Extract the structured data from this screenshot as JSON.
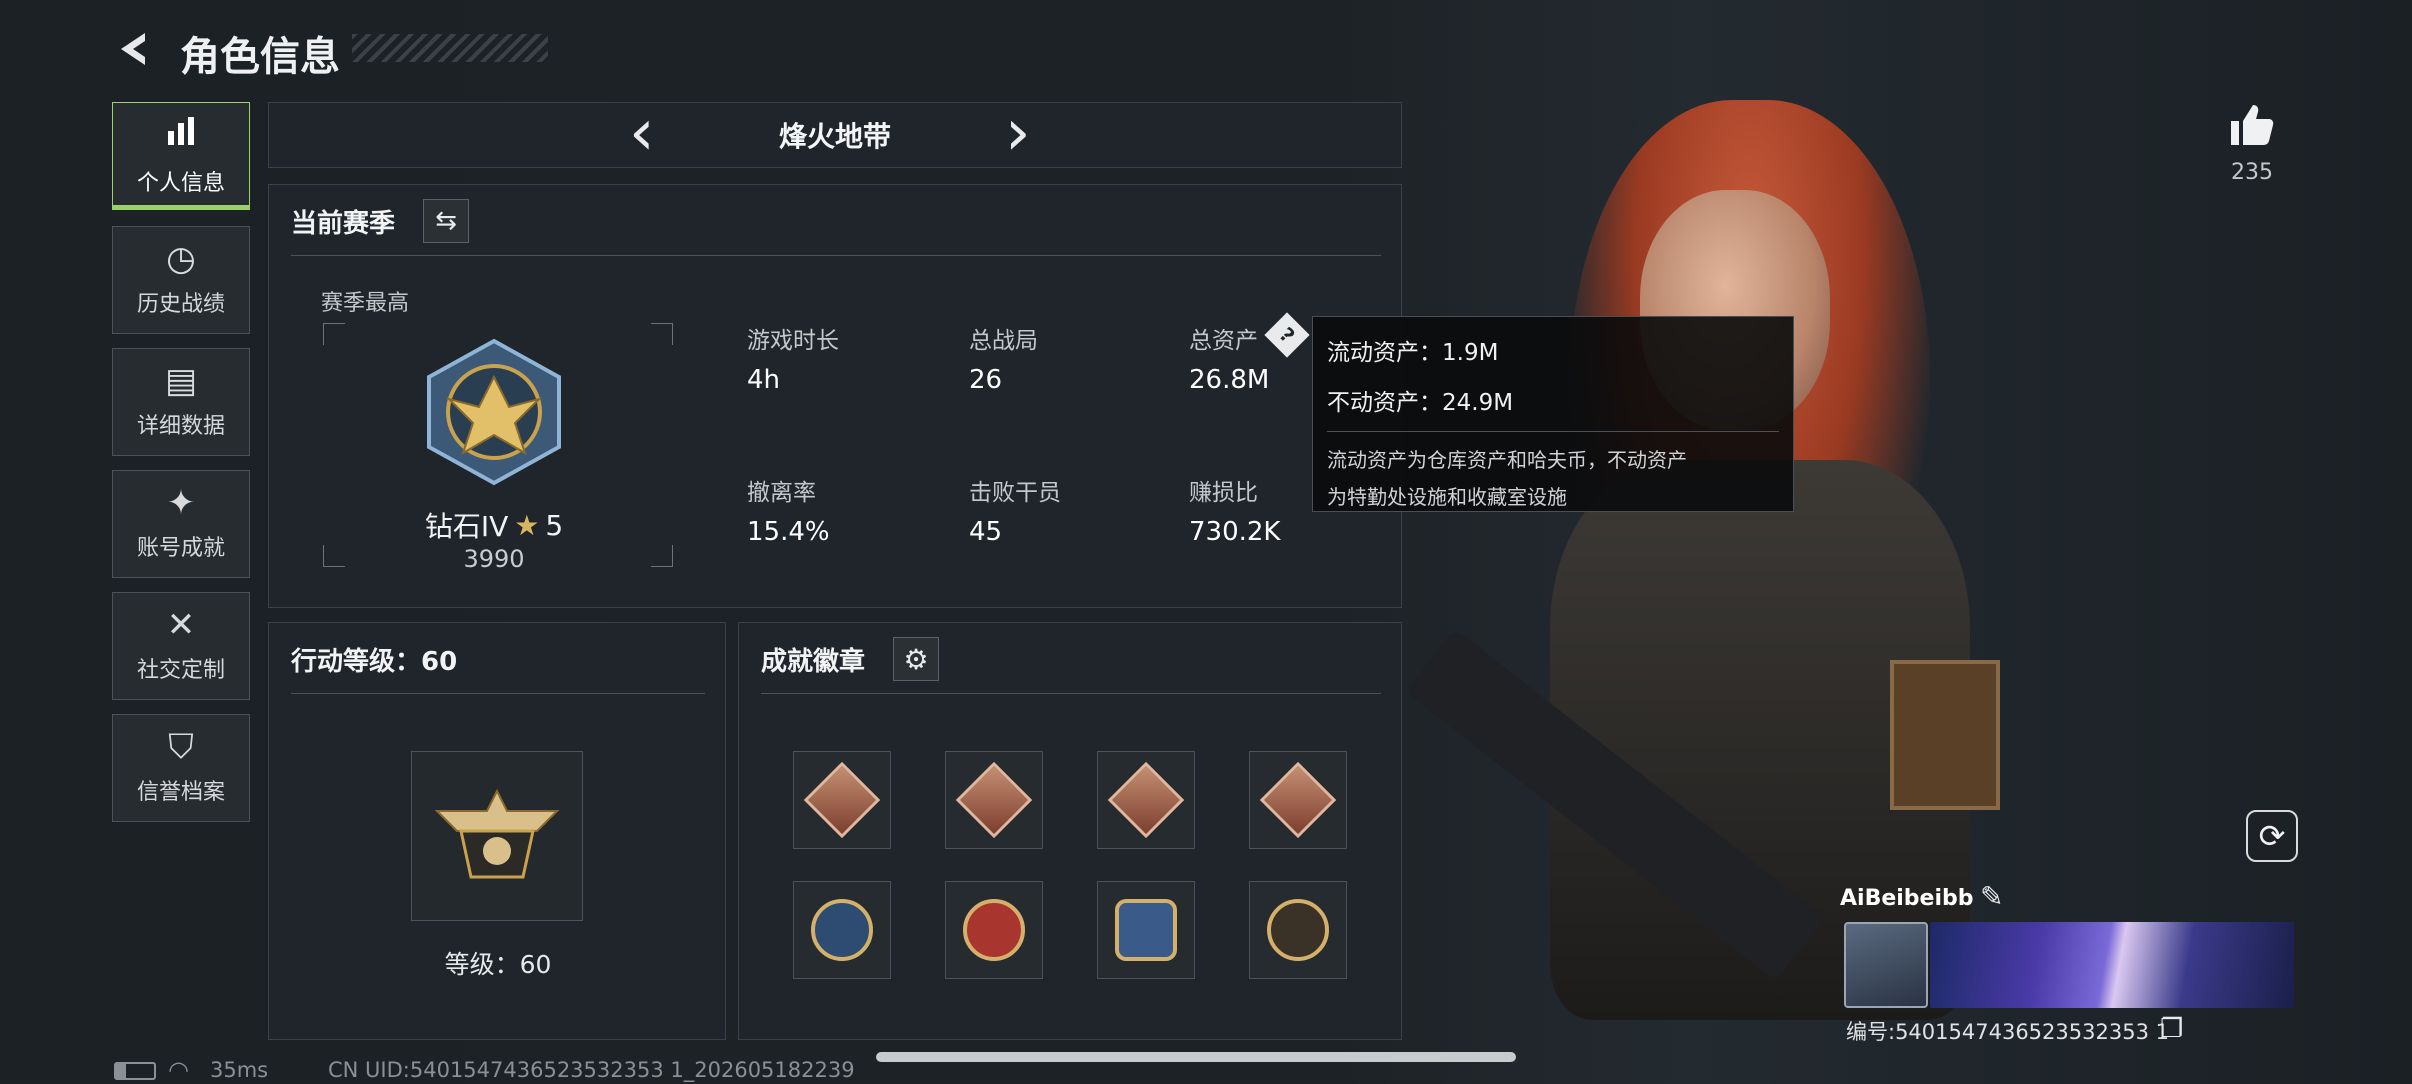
{
  "header": {
    "back_icon": "back-arrow-icon",
    "title": "角色信息"
  },
  "sidebar": {
    "items": [
      {
        "label": "个人信息",
        "icon": "bar-chart-icon",
        "glyph": "▮"
      },
      {
        "label": "历史战绩",
        "icon": "history-clock-icon",
        "glyph": "◷"
      },
      {
        "label": "详细数据",
        "icon": "folder-icon",
        "glyph": "▤"
      },
      {
        "label": "账号成就",
        "icon": "achievement-icon",
        "glyph": "✦"
      },
      {
        "label": "社交定制",
        "icon": "tools-icon",
        "glyph": "✕"
      },
      {
        "label": "信誉档案",
        "icon": "shield-icon",
        "glyph": "⛉"
      }
    ]
  },
  "mode_selector": {
    "title": "烽火地带",
    "prev_glyph": "‹",
    "next_glyph": "›"
  },
  "season": {
    "title": "当前赛季",
    "swap_glyph": "⇆",
    "best_label": "赛季最高",
    "rank": {
      "name": "钻石IV",
      "star_glyph": "★",
      "stars": "5",
      "score": "3990"
    },
    "stats": [
      {
        "label": "游戏时长",
        "value": "4h"
      },
      {
        "label": "总战局",
        "value": "26"
      },
      {
        "label": "总资产",
        "value": "26.8M"
      },
      {
        "label": "撤离率",
        "value": "15.4%"
      },
      {
        "label": "击败干员",
        "value": "45"
      },
      {
        "label": "赚损比",
        "value": "730.2K"
      }
    ],
    "help_glyph": "?"
  },
  "tooltip": {
    "line1": "流动资产：1.9M",
    "line2": "不动资产：24.9M",
    "desc1": "流动资产为仓库资产和哈夫币，不动资产",
    "desc2": "为特勤处设施和收藏室设施"
  },
  "action_level": {
    "title": "行动等级：60",
    "level_label": "等级：60"
  },
  "achievements": {
    "title": "成就徽章",
    "gear_glyph": "⚙"
  },
  "like": {
    "glyph": "👍",
    "count": "235"
  },
  "refresh_glyph": "⟳",
  "profile": {
    "name": "AiBeibeibb",
    "edit_glyph": "✎",
    "id_text": "编号:5401547436523532353 1",
    "copy_glyph": "❐"
  },
  "status_bar": {
    "ping": "35ms",
    "uid": "CN UID:5401547436523532353 1_202605182239"
  },
  "colors": {
    "accent": "#9bd06a",
    "panel": "#21262b",
    "text": "#e8eaec"
  }
}
